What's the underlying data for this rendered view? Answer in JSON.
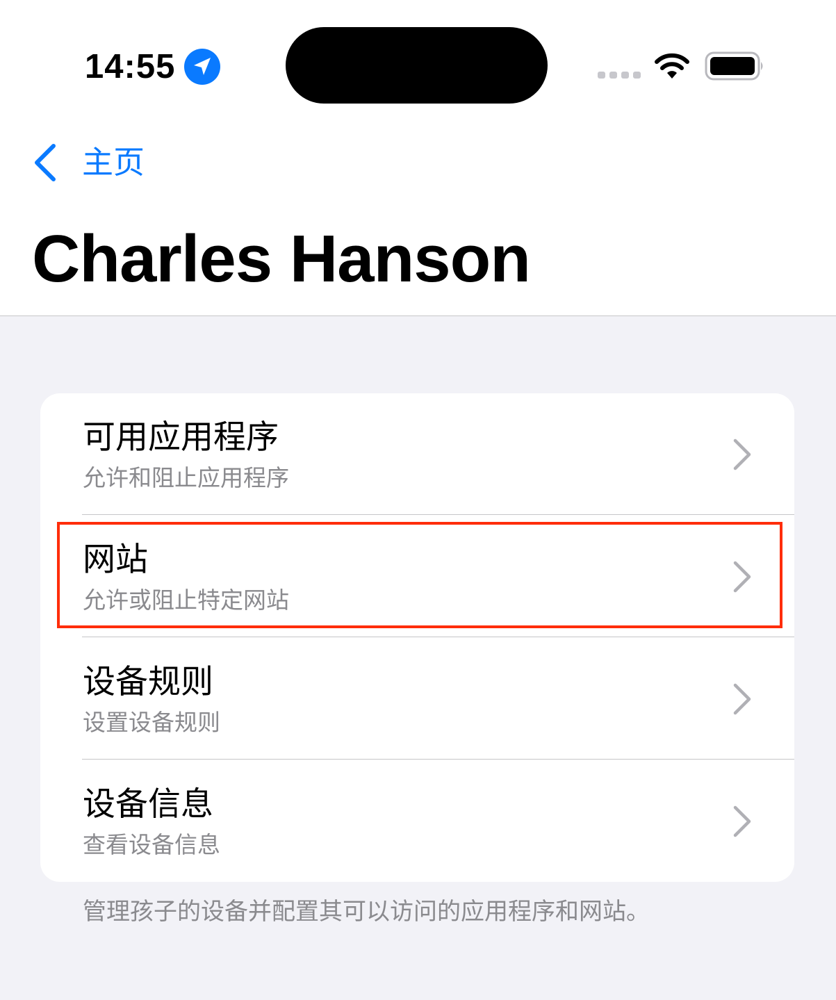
{
  "status_bar": {
    "time": "14:55",
    "icons": [
      "location-arrow-icon",
      "cellular-signal-icon",
      "wifi-icon",
      "battery-icon"
    ]
  },
  "nav": {
    "back_label": "主页",
    "back_icon": "chevron-left-icon"
  },
  "page": {
    "title": "Charles Hanson"
  },
  "menu": {
    "items": [
      {
        "title": "可用应用程序",
        "subtitle": "允许和阻止应用程序"
      },
      {
        "title": "网站",
        "subtitle": "允许或阻止特定网站"
      },
      {
        "title": "设备规则",
        "subtitle": "设置设备规则"
      },
      {
        "title": "设备信息",
        "subtitle": "查看设备信息"
      }
    ],
    "footer": "管理孩子的设备并配置其可以访问的应用程序和网站。"
  },
  "colors": {
    "accent": "#0a7aff",
    "highlight": "#ff2d0a",
    "background": "#f2f2f7",
    "secondary_text": "#8a8a8e"
  }
}
